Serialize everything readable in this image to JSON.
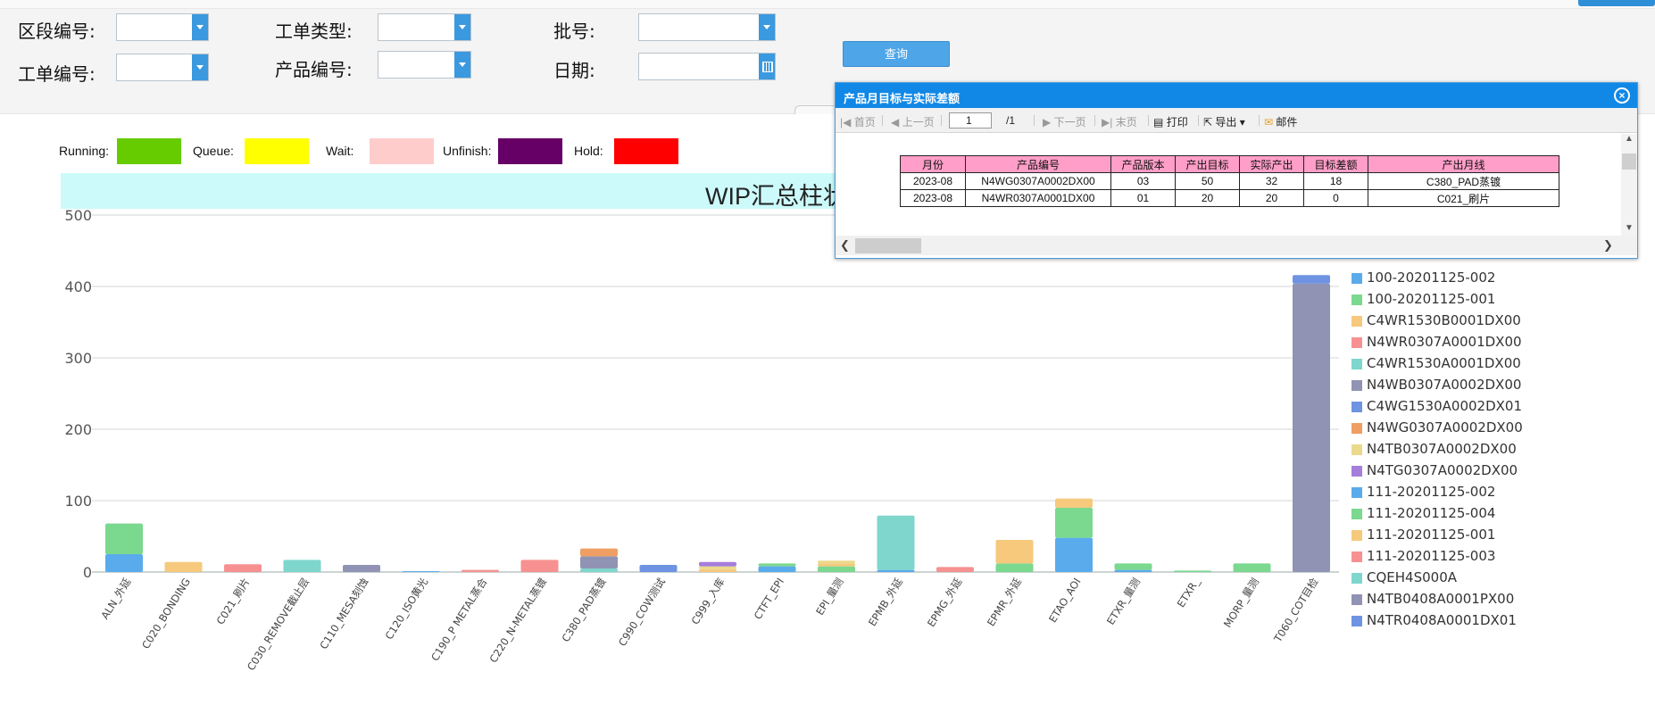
{
  "filters": {
    "section_no": "区段编号:",
    "work_order_type": "工单类型:",
    "batch_no": "批号:",
    "work_order_no": "工单编号:",
    "product_no": "产品编号:",
    "date": "日期:",
    "query_button": "查询"
  },
  "status_legend": [
    {
      "label": "Running:",
      "color": "#66cc00"
    },
    {
      "label": "Queue:",
      "color": "#ffff00"
    },
    {
      "label": "Wait:",
      "color": "#ffcccc"
    },
    {
      "label": "Unfinish:",
      "color": "#660066"
    },
    {
      "label": "Hold:",
      "color": "#ff0000"
    }
  ],
  "chart_data": {
    "type": "bar",
    "stacked": true,
    "title": "WIP汇总柱状",
    "ylim": [
      0,
      500
    ],
    "yticks": [
      0,
      100,
      200,
      300,
      400,
      500
    ],
    "grid": true,
    "legend_position": "right",
    "categories": [
      "ALN_外延",
      "C020_BONDING",
      "C021_刷片",
      "C030_REMOVE截止层",
      "C110_MESA刻蚀",
      "C120_ISO黄光",
      "C190_P METAL蒸合",
      "C220_N-METAL蒸镀",
      "C380_PAD蒸镀",
      "C990_COW测试",
      "C999_入库",
      "CTFT_EPI",
      "EPI_量测",
      "EPMB_外延",
      "EPMG_外延",
      "EPMR_外延",
      "ETAO_AOI",
      "ETXR_量测",
      "ETXR_",
      "MORP_量测",
      "T060_COT目检"
    ],
    "series": [
      {
        "name": "100-20201125-002",
        "color": "#5aabec",
        "values": [
          25,
          0,
          0,
          0,
          0,
          1,
          0,
          0,
          0,
          0,
          0,
          8,
          0,
          3,
          0,
          0,
          48,
          3,
          0,
          0,
          0
        ]
      },
      {
        "name": "100-20201125-001",
        "color": "#7bd88f",
        "values": [
          43,
          0,
          0,
          0,
          0,
          0,
          0,
          0,
          0,
          0,
          0,
          4,
          8,
          0,
          0,
          12,
          42,
          9,
          2,
          12,
          0
        ]
      },
      {
        "name": "C4WR1530B0001DX00",
        "color": "#f6c97d",
        "values": [
          0,
          14,
          0,
          0,
          0,
          0,
          0,
          0,
          0,
          0,
          4,
          0,
          4,
          0,
          0,
          33,
          13,
          0,
          0,
          0,
          0
        ]
      },
      {
        "name": "N4WR0307A0001DX00",
        "color": "#f79191",
        "values": [
          0,
          0,
          11,
          0,
          0,
          0,
          3,
          17,
          0,
          0,
          0,
          0,
          0,
          0,
          7,
          0,
          0,
          0,
          0,
          0,
          0
        ]
      },
      {
        "name": "C4WR1530A0001DX00",
        "color": "#7ed6cc",
        "values": [
          0,
          0,
          0,
          17,
          0,
          0,
          0,
          0,
          5,
          0,
          0,
          0,
          0,
          76,
          0,
          0,
          0,
          0,
          0,
          0,
          0
        ]
      },
      {
        "name": "N4WB0307A0002DX00",
        "color": "#9193b4",
        "values": [
          0,
          0,
          0,
          0,
          10,
          0,
          0,
          0,
          17,
          0,
          0,
          0,
          0,
          0,
          0,
          0,
          0,
          0,
          0,
          0,
          0
        ]
      },
      {
        "name": "C4WG1530A0002DX01",
        "color": "#6f93e3",
        "values": [
          0,
          0,
          0,
          0,
          0,
          0,
          0,
          0,
          0,
          10,
          0,
          0,
          0,
          0,
          0,
          0,
          0,
          0,
          0,
          0,
          0
        ]
      },
      {
        "name": "N4WG0307A0002DX00",
        "color": "#ef9f63",
        "values": [
          0,
          0,
          0,
          0,
          0,
          0,
          0,
          0,
          11,
          0,
          0,
          0,
          0,
          0,
          0,
          0,
          0,
          0,
          0,
          0,
          0
        ]
      },
      {
        "name": "N4TB0307A0002DX00",
        "color": "#ebd98c",
        "values": [
          0,
          0,
          0,
          0,
          0,
          0,
          0,
          0,
          0,
          0,
          4,
          0,
          4,
          0,
          0,
          0,
          0,
          0,
          0,
          0,
          0
        ]
      },
      {
        "name": "N4TG0307A0002DX00",
        "color": "#a57ddb",
        "values": [
          0,
          0,
          0,
          0,
          0,
          0,
          0,
          0,
          0,
          0,
          6,
          0,
          0,
          0,
          0,
          0,
          0,
          0,
          0,
          0,
          0
        ]
      },
      {
        "name": "111-20201125-002",
        "color": "#5aabec",
        "values": [
          0,
          0,
          0,
          0,
          0,
          0,
          0,
          0,
          0,
          0,
          0,
          0,
          0,
          0,
          0,
          0,
          0,
          0,
          0,
          0,
          0
        ]
      },
      {
        "name": "111-20201125-004",
        "color": "#7bd88f",
        "values": [
          0,
          0,
          0,
          0,
          0,
          0,
          0,
          0,
          0,
          0,
          0,
          0,
          0,
          0,
          0,
          0,
          0,
          0,
          0,
          0,
          0
        ]
      },
      {
        "name": "111-20201125-001",
        "color": "#f6c97d",
        "values": [
          0,
          0,
          0,
          0,
          0,
          0,
          0,
          0,
          0,
          0,
          0,
          0,
          0,
          0,
          0,
          0,
          0,
          0,
          0,
          0,
          0
        ]
      },
      {
        "name": "111-20201125-003",
        "color": "#f79191",
        "values": [
          0,
          0,
          0,
          0,
          0,
          0,
          0,
          0,
          0,
          0,
          0,
          0,
          0,
          0,
          0,
          0,
          0,
          0,
          0,
          0,
          0
        ]
      },
      {
        "name": "CQEH4S000A",
        "color": "#7ed6cc",
        "values": [
          0,
          0,
          0,
          0,
          0,
          0,
          0,
          0,
          0,
          0,
          0,
          0,
          0,
          0,
          0,
          0,
          0,
          0,
          0,
          0,
          0
        ]
      },
      {
        "name": "N4TB0408A0001PX00",
        "color": "#9193b4",
        "values": [
          0,
          0,
          0,
          0,
          0,
          0,
          0,
          0,
          0,
          0,
          0,
          0,
          0,
          0,
          0,
          0,
          0,
          0,
          0,
          0,
          404
        ]
      },
      {
        "name": "N4TR0408A0001DX01",
        "color": "#6f93e3",
        "values": [
          0,
          0,
          0,
          0,
          0,
          0,
          0,
          0,
          0,
          0,
          0,
          0,
          0,
          0,
          0,
          0,
          0,
          0,
          0,
          0,
          12
        ]
      }
    ]
  },
  "popup": {
    "title": "产品月目标与实际差额",
    "toolbar": {
      "first": "首页",
      "prev": "上一页",
      "page_value": "1",
      "page_total": "/1",
      "next": "下一页",
      "last": "末页",
      "print": "打印",
      "export": "导出",
      "mail": "邮件"
    },
    "table": {
      "headers": [
        "月份",
        "产品编号",
        "产品版本",
        "产出目标",
        "实际产出",
        "目标差额",
        "产出月线"
      ],
      "rows": [
        [
          "2023-08",
          "N4WG0307A0002DX00",
          "03",
          "50",
          "32",
          "18",
          "C380_PAD蒸镀"
        ],
        [
          "2023-08",
          "N4WR0307A0001DX00",
          "01",
          "20",
          "20",
          "0",
          "C021_刷片"
        ]
      ]
    }
  }
}
